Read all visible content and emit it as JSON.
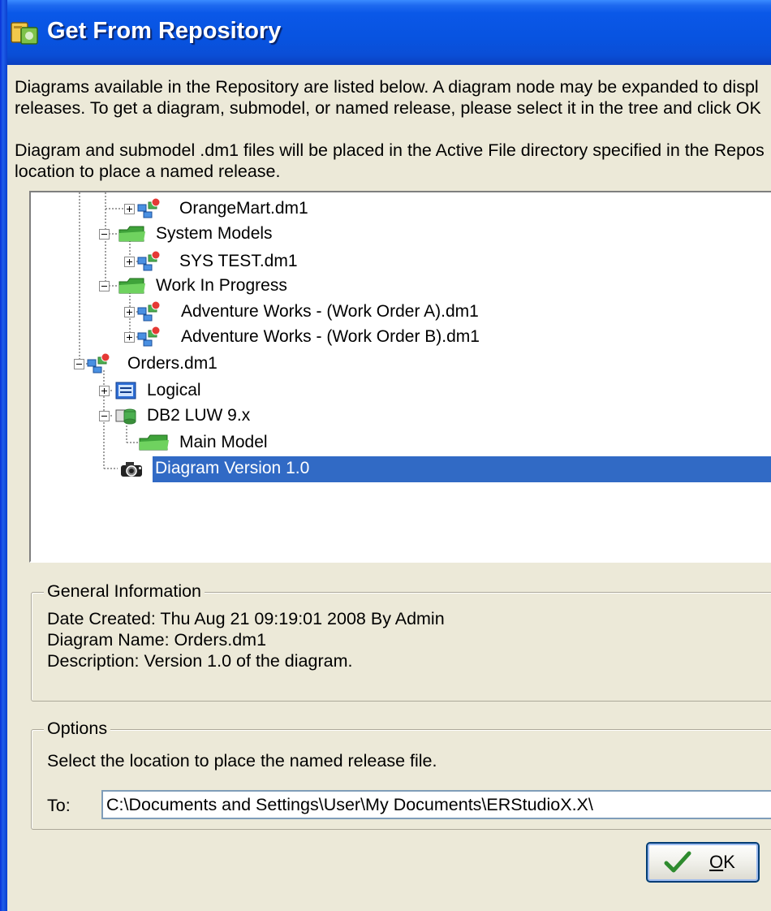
{
  "window": {
    "title": "Get From Repository"
  },
  "intro": {
    "line1": "Diagrams available in the Repository are listed below.  A diagram node may be expanded to displ",
    "line2": "releases.  To get a diagram, submodel, or named release, please select it in the tree and click OK",
    "line3": "Diagram and submodel .dm1 files will be placed in the Active File directory specified in the Repos",
    "line4": "location to place a named release."
  },
  "tree": {
    "items": [
      {
        "label": "OrangeMart.dm1"
      },
      {
        "label": "System Models"
      },
      {
        "label": "SYS TEST.dm1"
      },
      {
        "label": "Work In Progress"
      },
      {
        "label": "Adventure Works - (Work Order A).dm1"
      },
      {
        "label": "Adventure Works - (Work Order B).dm1"
      },
      {
        "label": "Orders.dm1"
      },
      {
        "label": "Logical"
      },
      {
        "label": "DB2 LUW 9.x"
      },
      {
        "label": "Main Model"
      },
      {
        "label": "Diagram Version 1.0"
      }
    ],
    "selected": "Diagram Version 1.0"
  },
  "general_info": {
    "title": "General Information",
    "date_created": "Date Created: Thu Aug 21 09:19:01 2008 By Admin",
    "diagram_name": "Diagram Name: Orders.dm1",
    "description": "Description: Version 1.0 of the diagram."
  },
  "options": {
    "title": "Options",
    "instruction": "Select the location to place the named release file.",
    "to_label": "To:",
    "to_value": "C:\\Documents and Settings\\User\\My Documents\\ERStudioX.X\\"
  },
  "buttons": {
    "ok_label_rest": "K",
    "ok_label_accel": "O"
  },
  "colors": {
    "titlebar": "#0a58e8",
    "selection": "#316ac5",
    "dialog_bg": "#ece9d8"
  },
  "icons": [
    "repository-dialog-icon",
    "diagram-icon",
    "folder-icon",
    "logical-model-icon",
    "physical-model-icon",
    "named-release-icon",
    "checkmark-icon"
  ]
}
